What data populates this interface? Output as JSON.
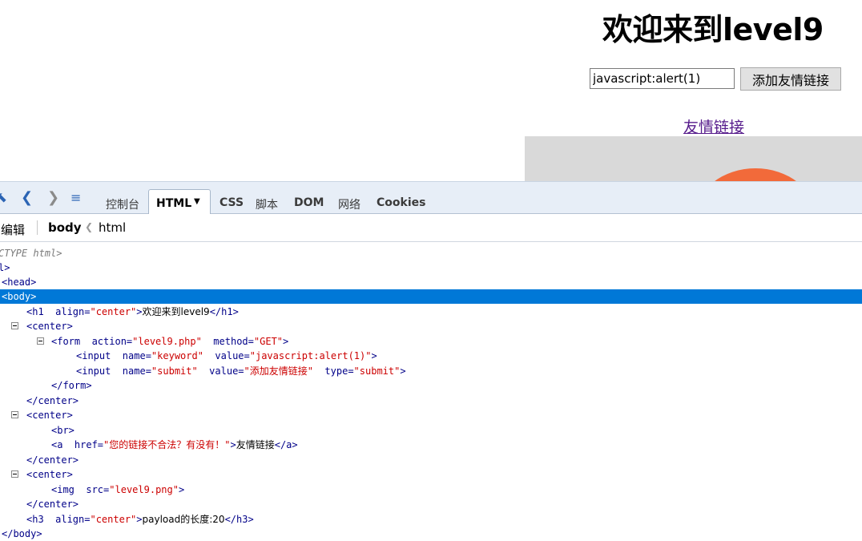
{
  "page": {
    "title": "欢迎来到level9",
    "input_value": "javascript:alert(1)",
    "submit_label": "添加友情链接",
    "link_text": "友情链接"
  },
  "devtools": {
    "tabs": [
      "控制台",
      "HTML",
      "CSS",
      "脚本",
      "DOM",
      "网络",
      "Cookies"
    ],
    "active_tab": "HTML",
    "edit_label": "编辑",
    "breadcrumb": [
      "body",
      "html"
    ]
  },
  "source_lines": [
    {
      "parts": [
        [
          "doctype",
          "CTYPE html>"
        ]
      ]
    },
    {
      "parts": [
        [
          "t",
          "l>"
        ]
      ]
    },
    {
      "parts": [
        [
          "t",
          "<head>"
        ]
      ]
    },
    {
      "parts": [
        [
          "t",
          "<body>"
        ]
      ]
    },
    {
      "parts": [
        [
          "t",
          "<h1  "
        ],
        [
          "an",
          "align="
        ],
        [
          "av",
          "\"center\""
        ],
        [
          "t",
          ">"
        ],
        [
          "tx",
          "欢迎来到level9"
        ],
        [
          "t",
          "</h1>"
        ]
      ]
    },
    {
      "parts": [
        [
          "t",
          "<center>"
        ]
      ]
    },
    {
      "parts": [
        [
          "t",
          "<form  "
        ],
        [
          "an",
          "action="
        ],
        [
          "av",
          "\"level9.php\""
        ],
        [
          "an",
          "  method="
        ],
        [
          "av",
          "\"GET\""
        ],
        [
          "t",
          ">"
        ]
      ]
    },
    {
      "parts": [
        [
          "t",
          "<input  "
        ],
        [
          "an",
          "name="
        ],
        [
          "av",
          "\"keyword\""
        ],
        [
          "an",
          "  value="
        ],
        [
          "av",
          "\"javascript:alert(1)\""
        ],
        [
          "t",
          ">"
        ]
      ]
    },
    {
      "parts": [
        [
          "t",
          "<input  "
        ],
        [
          "an",
          "name="
        ],
        [
          "av",
          "\"submit\""
        ],
        [
          "an",
          "  value="
        ],
        [
          "av",
          "\"添加友情链接\""
        ],
        [
          "an",
          "  type="
        ],
        [
          "av",
          "\"submit\""
        ],
        [
          "t",
          ">"
        ]
      ]
    },
    {
      "parts": [
        [
          "t",
          "</form>"
        ]
      ]
    },
    {
      "parts": [
        [
          "t",
          "</center>"
        ]
      ]
    },
    {
      "parts": [
        [
          "t",
          "<center>"
        ]
      ]
    },
    {
      "parts": [
        [
          "t",
          "<br>"
        ]
      ]
    },
    {
      "parts": [
        [
          "t",
          "<a  "
        ],
        [
          "an",
          "href="
        ],
        [
          "av",
          "\"您的链接不合法？有没有！\""
        ],
        [
          "t",
          ">"
        ],
        [
          "tx",
          "友情链接"
        ],
        [
          "t",
          "</a>"
        ]
      ]
    },
    {
      "parts": [
        [
          "t",
          "</center>"
        ]
      ]
    },
    {
      "parts": [
        [
          "t",
          "<center>"
        ]
      ]
    },
    {
      "parts": [
        [
          "t",
          "<img  "
        ],
        [
          "an",
          "src="
        ],
        [
          "av",
          "\"level9.png\""
        ],
        [
          "t",
          ">"
        ]
      ]
    },
    {
      "parts": [
        [
          "t",
          "</center>"
        ]
      ]
    },
    {
      "parts": [
        [
          "t",
          "<h3  "
        ],
        [
          "an",
          "align="
        ],
        [
          "av",
          "\"center\""
        ],
        [
          "t",
          ">"
        ],
        [
          "tx",
          "payload的长度:20"
        ],
        [
          "t",
          "</h3>"
        ]
      ]
    },
    {
      "parts": [
        [
          "t",
          "</body>"
        ]
      ]
    }
  ],
  "colors": {
    "selection": "#0078d7",
    "tag": "#000088",
    "attr_value": "#cc0000",
    "link": "#551a8b"
  }
}
